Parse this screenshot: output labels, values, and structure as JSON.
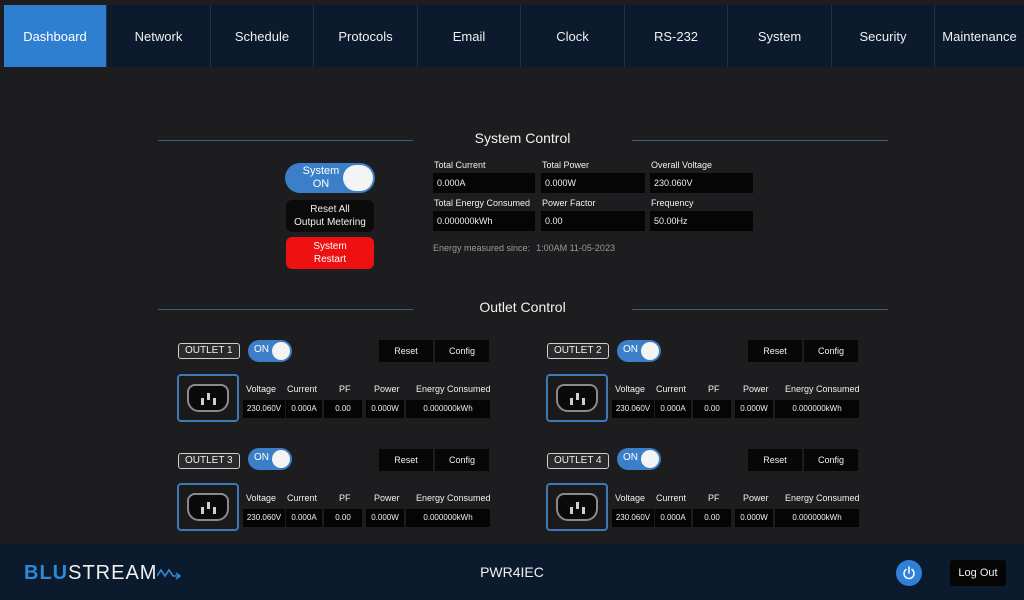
{
  "nav": {
    "tabs": [
      {
        "label": "Dashboard"
      },
      {
        "label": "Network"
      },
      {
        "label": "Schedule"
      },
      {
        "label": "Protocols"
      },
      {
        "label": "Email"
      },
      {
        "label": "Clock"
      },
      {
        "label": "RS-232"
      },
      {
        "label": "System"
      },
      {
        "label": "Security"
      },
      {
        "label": "Maintenance"
      }
    ],
    "active_index": 0
  },
  "system_control": {
    "title": "System Control",
    "toggle_label": "System ON",
    "toggle_line1": "System",
    "toggle_line2": "ON",
    "reset_all_line1": "Reset All",
    "reset_all_line2": "Output Metering",
    "restart_line1": "System",
    "restart_line2": "Restart",
    "metrics": [
      {
        "label": "Total Current",
        "value": "0.000A"
      },
      {
        "label": "Total Power",
        "value": "0.000W"
      },
      {
        "label": "Overall Voltage",
        "value": "230.060V"
      },
      {
        "label": "Total Energy Consumed",
        "value": "0.000000kWh"
      },
      {
        "label": "Power Factor",
        "value": "0.00"
      },
      {
        "label": "Frequency",
        "value": "50.00Hz"
      }
    ],
    "energy_since_label": "Energy measured since:",
    "energy_since_value": "1:00AM 11-05-2023"
  },
  "outlet_control": {
    "title": "Outlet Control",
    "columns": [
      "Voltage",
      "Current",
      "PF",
      "Power",
      "Energy Consumed"
    ],
    "reset_label": "Reset",
    "config_label": "Config",
    "toggle_label": "ON",
    "outlets": [
      {
        "name": "OUTLET 1",
        "voltage": "230.060V",
        "current": "0.000A",
        "pf": "0.00",
        "power": "0.000W",
        "energy": "0.000000kWh"
      },
      {
        "name": "OUTLET 2",
        "voltage": "230.060V",
        "current": "0.000A",
        "pf": "0.00",
        "power": "0.000W",
        "energy": "0.000000kWh"
      },
      {
        "name": "OUTLET 3",
        "voltage": "230.060V",
        "current": "0.000A",
        "pf": "0.00",
        "power": "0.000W",
        "energy": "0.000000kWh"
      },
      {
        "name": "OUTLET 4",
        "voltage": "230.060V",
        "current": "0.000A",
        "pf": "0.00",
        "power": "0.000W",
        "energy": "0.000000kWh"
      }
    ]
  },
  "footer": {
    "logo_bold": "BLU",
    "logo_rest": "STREAM",
    "device_name": "PWR4IEC",
    "power_icon": "power-icon",
    "logout_label": "Log Out"
  },
  "colors": {
    "accent": "#2f80d8",
    "nav_bg": "#0c1a2e",
    "restart_red": "#ee1111"
  }
}
